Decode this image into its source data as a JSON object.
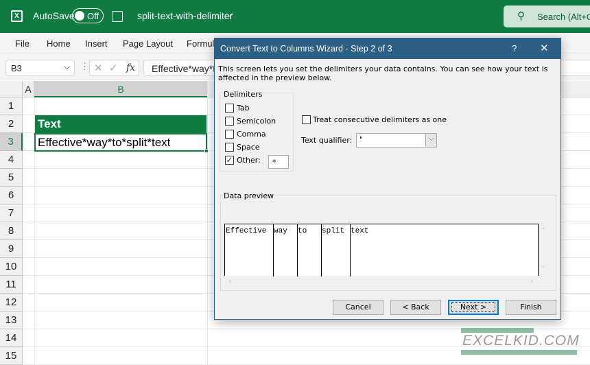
{
  "titlebar": {
    "autosave_label": "AutoSave",
    "autosave_state": "Off",
    "filename": "split-text-with-delimiter",
    "search_placeholder": "Search (Alt+C"
  },
  "ribbon": {
    "tabs": [
      "File",
      "Home",
      "Insert",
      "Page Layout",
      "Formul"
    ]
  },
  "formula_bar": {
    "name_box": "B3",
    "fx": "fx",
    "content": "Effective*way*to*split*text"
  },
  "sheet": {
    "columns": [
      "A",
      "B"
    ],
    "rows": [
      "1",
      "2",
      "3",
      "4",
      "5",
      "6",
      "7",
      "8",
      "9",
      "10",
      "11",
      "12",
      "13",
      "14",
      "15"
    ],
    "b2": "Text",
    "b3": "Effective*way*to*split*text",
    "header_fill": "#107c41"
  },
  "dialog": {
    "title": "Convert Text to Columns Wizard - Step 2 of 3",
    "help": "?",
    "close": "✕",
    "description": "This screen lets you set the delimiters your data contains.  You can see how your text is affected in the preview below.",
    "delimiters_label": "Delimiters",
    "delimiters": [
      {
        "label": "Tab",
        "checked": false
      },
      {
        "label": "Semicolon",
        "checked": false
      },
      {
        "label": "Comma",
        "checked": false
      },
      {
        "label": "Space",
        "checked": false
      },
      {
        "label": "Other:",
        "checked": true
      }
    ],
    "other_value": "*",
    "consecutive_label": "Treat consecutive delimiters as one",
    "consecutive_checked": false,
    "qualifier_label": "Text qualifier:",
    "qualifier_value": "\"",
    "preview_label": "Data preview",
    "preview_columns": [
      "Effective",
      "way",
      "to",
      "split",
      "text"
    ],
    "buttons": {
      "cancel": "Cancel",
      "back": "< Back",
      "next": "Next >",
      "finish": "Finish"
    }
  },
  "watermark": "EXCELKID.COM"
}
